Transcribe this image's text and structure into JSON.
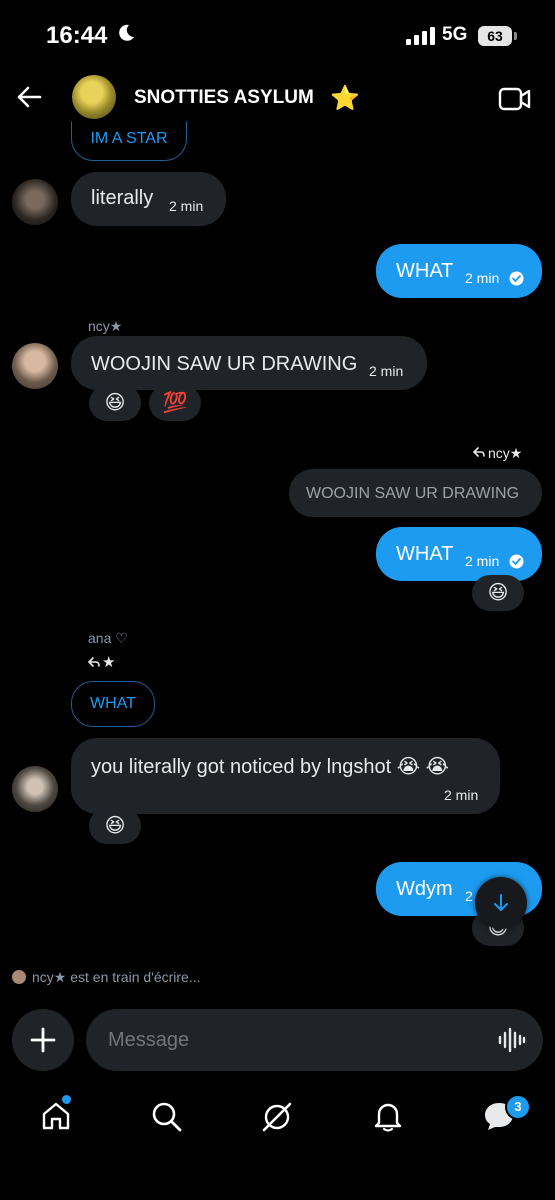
{
  "status_bar": {
    "time": "16:44",
    "network": "5G",
    "battery": "63"
  },
  "header": {
    "group_name": "SNOTTIES ASYLUM",
    "group_emoji": "⭐"
  },
  "messages": {
    "quote_top": "IM A STAR",
    "m1": {
      "text": "literally",
      "time": "2 min"
    },
    "m2": {
      "text": "WHAT",
      "time": "2 min"
    },
    "m3": {
      "sender": "ncy★",
      "text": "WOOJIN SAW UR DRAWING",
      "time": "2 min",
      "reactions": [
        "😆",
        "💯"
      ]
    },
    "m4": {
      "reply_to": "ncy★",
      "quoted": "WOOJIN SAW UR DRAWING",
      "text": "WHAT",
      "time": "2 min",
      "reaction": "😆"
    },
    "m5": {
      "sender": "ana ♡",
      "reply_to": "★",
      "quoted": "WHAT",
      "text": "you literally got noticed by lngshot 😭 😭",
      "time": "2 min",
      "reaction": "😆"
    },
    "m6": {
      "text": "Wdym",
      "time": "2",
      "reaction": "😆"
    }
  },
  "typing": {
    "text": "ncy★ est en train d'écrire..."
  },
  "composer": {
    "placeholder": "Message"
  },
  "bottom_nav": {
    "badge": "3"
  }
}
